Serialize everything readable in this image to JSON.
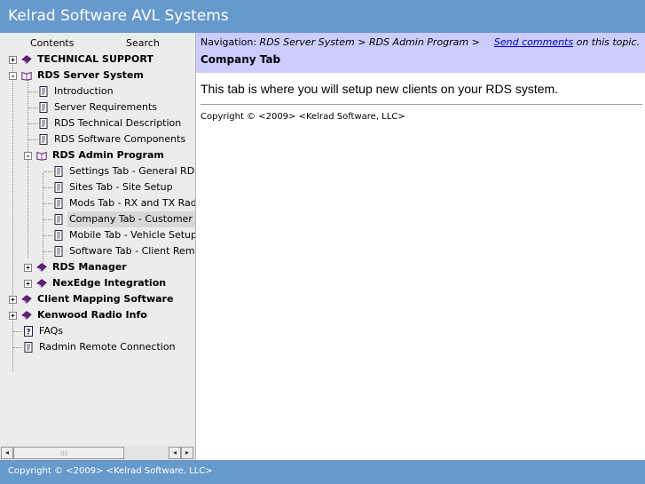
{
  "app_title": "Kelrad Software AVL Systems",
  "sidebar": {
    "tabs": [
      "Contents",
      "Search"
    ],
    "tree": [
      {
        "label": "TECHNICAL SUPPORT",
        "icon": "book-closed-icon",
        "expander": "+"
      },
      {
        "label": "RDS Server System",
        "icon": "book-open-icon",
        "expander": "-"
      },
      {
        "label": "Introduction",
        "icon": "page-icon"
      },
      {
        "label": "Server Requirements",
        "icon": "page-icon"
      },
      {
        "label": "RDS Technical Description",
        "icon": "page-icon"
      },
      {
        "label": "RDS Software Components",
        "icon": "page-icon"
      },
      {
        "label": "RDS Admin Program",
        "icon": "book-open-icon",
        "expander": "-"
      },
      {
        "label": "Settings Tab - General RDS",
        "icon": "page-icon"
      },
      {
        "label": "Sites Tab - Site Setup",
        "icon": "page-icon"
      },
      {
        "label": "Mods Tab - RX and TX Radic",
        "icon": "page-icon"
      },
      {
        "label": "Company Tab - Customer S",
        "icon": "page-icon",
        "selected": true
      },
      {
        "label": "Mobile Tab - Vehicle Setup",
        "icon": "page-icon"
      },
      {
        "label": "Software Tab - Client Remo",
        "icon": "page-icon"
      },
      {
        "label": "RDS Manager",
        "icon": "book-closed-icon",
        "expander": "+"
      },
      {
        "label": "NexEdge Integration",
        "icon": "book-closed-icon",
        "expander": "+"
      },
      {
        "label": "Client Mapping Software",
        "icon": "book-closed-icon",
        "expander": "+"
      },
      {
        "label": "Kenwood Radio Info",
        "icon": "book-closed-icon",
        "expander": "+"
      },
      {
        "label": "FAQs",
        "icon": "question-page-icon"
      },
      {
        "label": "Radmin Remote Connection",
        "icon": "page-icon"
      }
    ],
    "scroll_left": "◂",
    "scroll_right_a": "◂",
    "scroll_right_b": "▸"
  },
  "navigation": {
    "prefix": "Navigation:",
    "crumb1": "RDS Server System",
    "sep": ">",
    "crumb2": "RDS Admin Program",
    "feedback_link": "Send comments",
    "feedback_suffix": " on this topic."
  },
  "page": {
    "title": "Company Tab",
    "body": "This tab is where you will setup new clients on your RDS system.",
    "copyright": "Copyright © <2009> <Kelrad Software, LLC>"
  },
  "footer": {
    "copyright": "Copyright © <2009> <Kelrad Software, LLC>"
  },
  "colors": {
    "header": "#6699cc",
    "nav_bar": "#ccccff",
    "book": "#6a1b8a",
    "link": "#0000cc"
  }
}
